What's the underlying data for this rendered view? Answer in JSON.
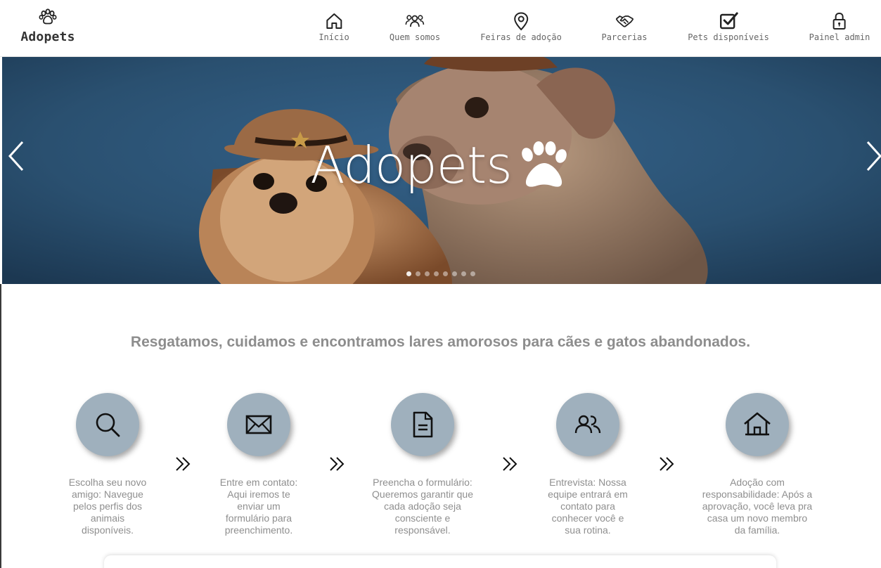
{
  "brand": {
    "name": "Adopets",
    "icon": "paw-icon"
  },
  "nav": {
    "items": [
      {
        "label": "Início",
        "icon": "home-icon"
      },
      {
        "label": "Quem somos",
        "icon": "users-icon"
      },
      {
        "label": "Feiras de adoção",
        "icon": "map-pin-icon"
      },
      {
        "label": "Parcerias",
        "icon": "handshake-icon"
      },
      {
        "label": "Pets disponíveis",
        "icon": "checkbox-icon"
      },
      {
        "label": "Painel admin",
        "icon": "lock-icon"
      }
    ]
  },
  "hero": {
    "title": "Adopets",
    "indicators_count": 8,
    "active_indicator": 1
  },
  "intro": {
    "tagline": "Resgatamos, cuidamos e encontramos lares amorosos para cães e gatos abandonados."
  },
  "steps": [
    {
      "icon": "search-icon",
      "text": "Escolha seu novo\namigo: Navegue\npelos perfis dos\nanimais\ndisponíveis."
    },
    {
      "icon": "envelope-icon",
      "text": "Entre em contato:\nAqui iremos te\nenviar um\nformulário para\npreenchimento."
    },
    {
      "icon": "document-icon",
      "text": "Preencha o formulário:\nQueremos garantir que\ncada adoção seja\nconsciente e\nresponsável."
    },
    {
      "icon": "people-icon",
      "text": "Entrevista: Nossa\nequipe entrará em\ncontato para\nconhecer você e\nsua rotina."
    },
    {
      "icon": "house-icon",
      "text": "Adoção com\nresponsabilidade: Após a\naprovação, você leva pra\ncasa um novo membro\nda família."
    }
  ],
  "colors": {
    "hero_background": "#2e5677",
    "step_circle": "#9fb0bd",
    "muted_text": "#8f8f8f"
  }
}
